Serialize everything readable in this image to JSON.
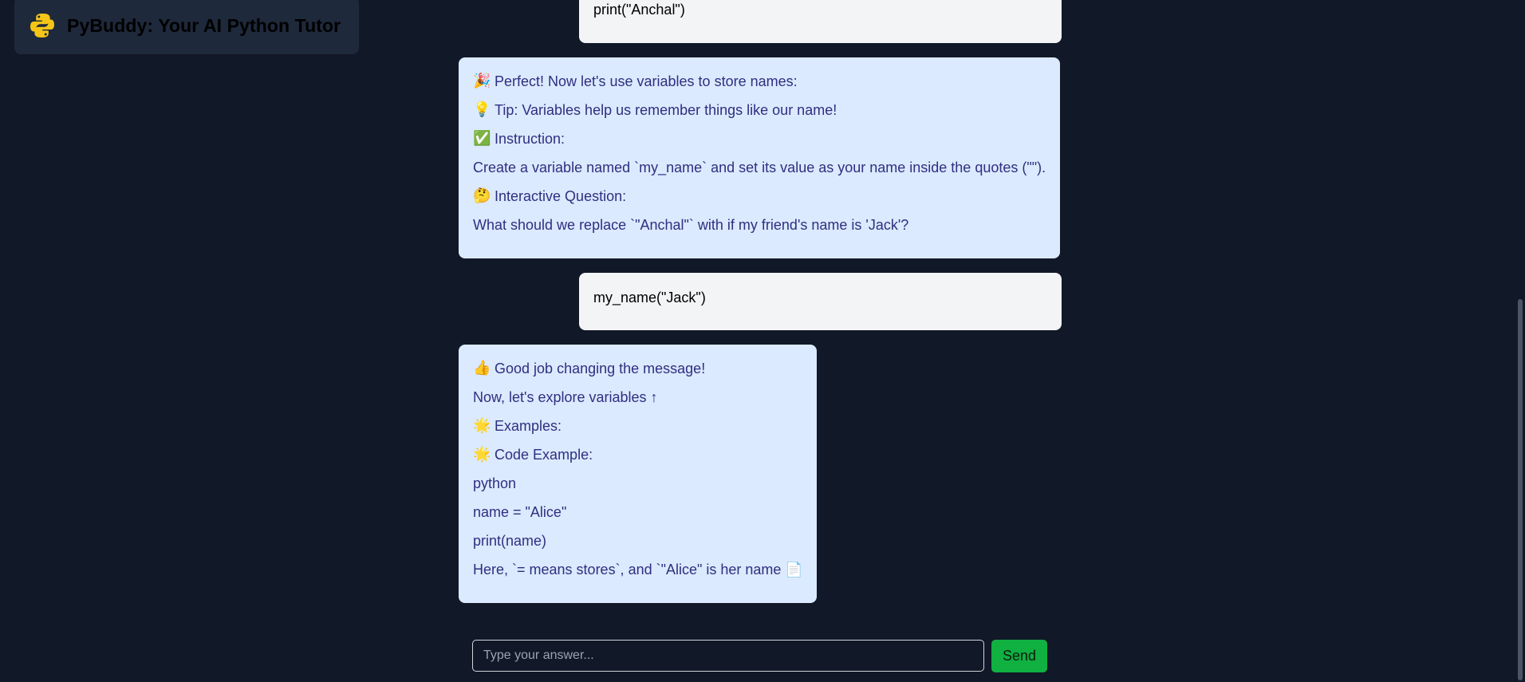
{
  "app": {
    "title": "PyBuddy: Your AI Python Tutor"
  },
  "messages": [
    {
      "role": "user",
      "lines": [
        "print(\"Anchal\")"
      ]
    },
    {
      "role": "bot",
      "lines": [
        {
          "emoji": "🎉",
          "text": "Perfect! Now let's use variables to store names:"
        },
        {
          "emoji": "💡",
          "text": "Tip: Variables help us remember things like our name!"
        },
        {
          "emoji": "✅",
          "text": "Instruction:"
        },
        {
          "emoji": "",
          "text": "Create a variable named `my_name` and set its value as your name inside the quotes (\"\")."
        },
        {
          "emoji": "🤔",
          "text": "Interactive Question:"
        },
        {
          "emoji": "",
          "text": "What should we replace `\"Anchal\"` with if my friend's name is 'Jack'?"
        }
      ]
    },
    {
      "role": "user",
      "lines": [
        "my_name(\"Jack\")"
      ]
    },
    {
      "role": "bot",
      "lines": [
        {
          "emoji": "👍",
          "text": "Good job changing the message!"
        },
        {
          "emoji": "",
          "text": "Now, let's explore variables ↑"
        },
        {
          "emoji": "🌟",
          "text": "Examples:"
        },
        {
          "emoji": "🌟",
          "text": "Code Example:"
        },
        {
          "emoji": "",
          "text": "python"
        },
        {
          "emoji": "",
          "text": "name = \"Alice\""
        },
        {
          "emoji": "",
          "text": "print(name)"
        },
        {
          "emoji": "",
          "text": "Here, `= means stores`, and `\"Alice\" is her name 📄"
        }
      ]
    }
  ],
  "composer": {
    "placeholder": "Type your answer...",
    "send_label": "Send"
  },
  "colors": {
    "background": "#111827",
    "user_bubble": "#f3f4f6",
    "bot_bubble": "#dbeafe",
    "bot_text": "#312e81",
    "send_button": "#10b041"
  }
}
